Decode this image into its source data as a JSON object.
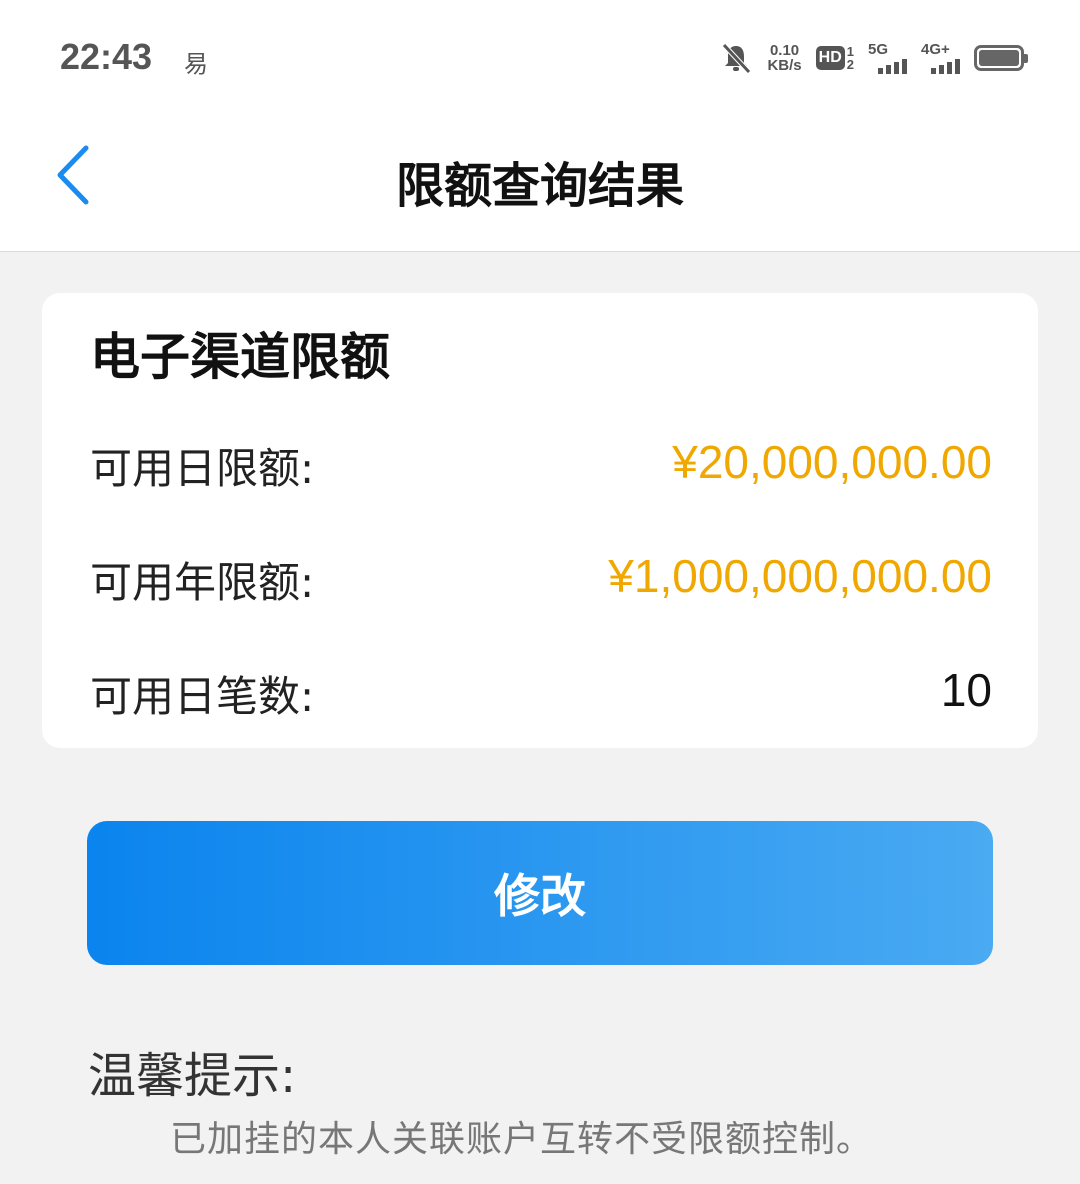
{
  "status_bar": {
    "time": "22:43",
    "app_glyph": "易",
    "net_speed_value": "0.10",
    "net_speed_unit": "KB/s",
    "hd_label": "HD",
    "hd_slot_top": "1",
    "hd_slot_bottom": "2",
    "signal1_label": "5G",
    "signal2_label": "4G+"
  },
  "nav": {
    "title": "限额查询结果"
  },
  "card": {
    "title": "电子渠道限额",
    "rows": [
      {
        "label": "可用日限额:",
        "value": "¥20,000,000.00"
      },
      {
        "label": "可用年限额:",
        "value": "¥1,000,000,000.00"
      },
      {
        "label": "可用日笔数:",
        "value": "10"
      }
    ]
  },
  "actions": {
    "modify_label": "修改"
  },
  "tips": {
    "title": "温馨提示:",
    "text": "已加挂的本人关联账户互转不受限额控制。"
  },
  "colors": {
    "accent": "#1a8cf0",
    "amount": "#f0a800",
    "back_arrow": "#1a8cf0"
  }
}
